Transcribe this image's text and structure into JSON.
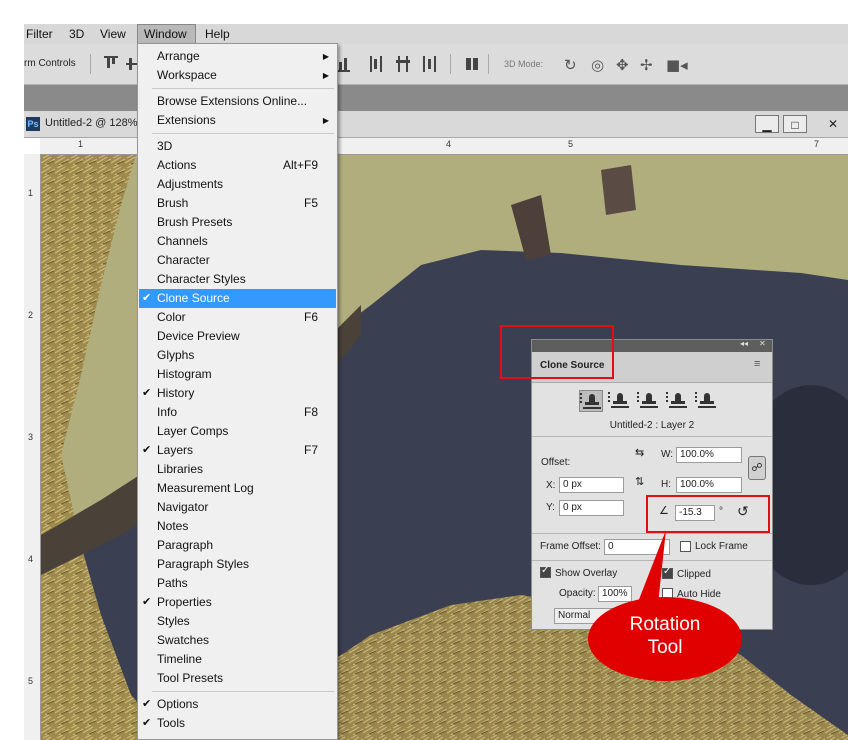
{
  "menubar": {
    "items": [
      "Filter",
      "3D",
      "View",
      "Window",
      "Help"
    ],
    "active": "Window"
  },
  "optionsbar": {
    "transform_controls": "rm Controls",
    "mode_label": "3D Mode:"
  },
  "document": {
    "tab_title": "Untitled-2 @ 128%",
    "app_badge": "Ps",
    "win_min": "▁",
    "win_max": "□",
    "win_close": "✕"
  },
  "rulers": {
    "h": [
      "1",
      "4",
      "5",
      "7"
    ],
    "v": [
      "1",
      "2",
      "3",
      "4",
      "5"
    ]
  },
  "menu": {
    "items": [
      {
        "label": "Arrange",
        "submenu": true
      },
      {
        "label": "Workspace",
        "submenu": true
      },
      {
        "sep": true
      },
      {
        "label": "Browse Extensions Online..."
      },
      {
        "label": "Extensions",
        "submenu": true
      },
      {
        "sep": true
      },
      {
        "label": "3D"
      },
      {
        "label": "Actions",
        "shortcut": "Alt+F9"
      },
      {
        "label": "Adjustments"
      },
      {
        "label": "Brush",
        "shortcut": "F5"
      },
      {
        "label": "Brush Presets"
      },
      {
        "label": "Channels"
      },
      {
        "label": "Character"
      },
      {
        "label": "Character Styles"
      },
      {
        "label": "Clone Source",
        "checked": true,
        "highlighted": true
      },
      {
        "label": "Color",
        "shortcut": "F6"
      },
      {
        "label": "Device Preview"
      },
      {
        "label": "Glyphs"
      },
      {
        "label": "Histogram"
      },
      {
        "label": "History",
        "checked": true
      },
      {
        "label": "Info",
        "shortcut": "F8"
      },
      {
        "label": "Layer Comps"
      },
      {
        "label": "Layers",
        "shortcut": "F7",
        "checked": true
      },
      {
        "label": "Libraries"
      },
      {
        "label": "Measurement Log"
      },
      {
        "label": "Navigator"
      },
      {
        "label": "Notes"
      },
      {
        "label": "Paragraph"
      },
      {
        "label": "Paragraph Styles"
      },
      {
        "label": "Paths"
      },
      {
        "label": "Properties",
        "checked": true
      },
      {
        "label": "Styles"
      },
      {
        "label": "Swatches"
      },
      {
        "label": "Timeline"
      },
      {
        "label": "Tool Presets"
      },
      {
        "sep": true
      },
      {
        "label": "Options",
        "checked": true
      },
      {
        "label": "Tools",
        "checked": true
      }
    ]
  },
  "clone_panel": {
    "title": "Clone Source",
    "collapse": "◂◂",
    "close": "✕",
    "source": "Untitled-2 : Layer 2",
    "offset_label": "Offset:",
    "w_label": "W:",
    "w": "100.0%",
    "h_label": "H:",
    "h": "100.0%",
    "x_label": "X:",
    "x": "0 px",
    "y_label": "Y:",
    "y": "0 px",
    "angle": "-15.3",
    "degree": "°",
    "frame_offset_label": "Frame Offset:",
    "frame_offset": "0",
    "lock_frame": "Lock Frame",
    "show_overlay": "Show Overlay",
    "clipped": "Clipped",
    "opacity_label": "Opacity:",
    "opacity": "100%",
    "auto_hide": "Auto Hide",
    "blend": "Normal"
  },
  "callout": {
    "line1": "Rotation",
    "line2": "Tool"
  },
  "colors": {
    "highlight": "#3399ff",
    "annotation": "#e01010"
  }
}
